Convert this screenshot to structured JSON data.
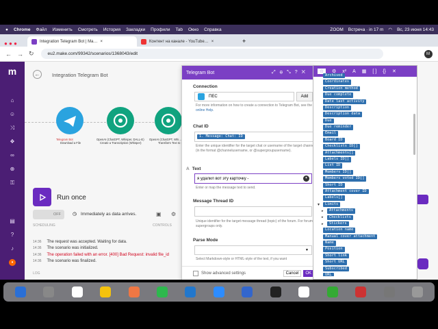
{
  "menubar": {
    "app": "Chrome",
    "items": [
      "Файл",
      "Изменить",
      "Смотреть",
      "История",
      "Закладки",
      "Профили",
      "Tab",
      "Окно",
      "Справка"
    ],
    "zoom": "ZOOM",
    "meeting": "Встреча · in 17 m",
    "datetime": "Вс, 23 июня 14:43"
  },
  "tabs": [
    {
      "label": "Integration Telegram Bot | Ma…",
      "active": true
    },
    {
      "label": "Контент на канале - YouTube…",
      "active": false
    }
  ],
  "address": {
    "url": "eu2.make.com/99342/scenarios/1368043/edit",
    "profile": "M"
  },
  "scenario": {
    "title": "Integration Telegram Bot",
    "nodes": [
      {
        "label": "Telegram Bot",
        "sub": "Download a File",
        "badge": "1"
      },
      {
        "label": "OpenAI (ChatGPT, Whisper, DALL-E)",
        "sub": "Create a Transcription (Whisper)",
        "badge": "2"
      },
      {
        "label": "OpenAI (ChatGPT, Whi…",
        "sub": "Transform Text to Speech",
        "badge": "3"
      }
    ],
    "run_once": "Run once",
    "toggle": "OFF",
    "schedule_text": "Immediately as data arrives.",
    "scheduling_label": "SCHEDULING",
    "controls_label": "CONTROLS",
    "log_label": "LOG",
    "logs": [
      {
        "time": "14:36",
        "text": "The request was accepted. Waiting for data.",
        "error": false
      },
      {
        "time": "14:36",
        "text": "The scenario was initialized.",
        "error": false
      },
      {
        "time": "14:36",
        "text": "The operation failed with an error. [400] Bad Request: invalid file_id",
        "error": true
      },
      {
        "time": "14:36",
        "text": "The scenario was finalized.",
        "error": false
      }
    ]
  },
  "panel": {
    "title": "Telegram Bot",
    "connection_title": "Connection",
    "connection_value": "ПЕС",
    "add_label": "Add",
    "connection_help": "For more information on how to create a connection to Telegram Bot, see the",
    "online_help": "online Help.",
    "chatid_title": "Chat ID",
    "chatid_chip": "1. Message: Chat: ID",
    "chatid_help": "Enter the unique identifier for the target chat or username of the target channel (in the format @channelusername, or @supergroupusername).",
    "text_title": "Text",
    "text_value": "я удалил вот эту карточку -",
    "text_help": "Enter or map the message text to send.",
    "thread_title": "Message Thread ID",
    "thread_help": "Unique identifier for the target message thread (topic) of the forum. For forum supergroups only.",
    "parse_title": "Parse Mode",
    "parse_help": "Select Markdown-style or HTML-style of the text, if you want",
    "advanced_label": "Show advanced settings",
    "cancel_label": "Cancel",
    "ok_label": "OK"
  },
  "picker": {
    "items": [
      {
        "label": "Archived",
        "sub": false
      },
      {
        "label": "Coordinates",
        "sub": false
      },
      {
        "label": "Creation method",
        "sub": false
      },
      {
        "label": "Due complete",
        "sub": false
      },
      {
        "label": "Date last activity",
        "sub": false
      },
      {
        "label": "Description",
        "sub": false
      },
      {
        "label": "Description data",
        "sub": false
      },
      {
        "label": "Due",
        "sub": false
      },
      {
        "label": "Due reminder",
        "sub": false
      },
      {
        "label": "Email",
        "sub": false
      },
      {
        "label": "Board ID",
        "sub": false
      },
      {
        "label": "Checklists ID[]",
        "sub": false
      },
      {
        "label": "Attachments[]",
        "sub": false
      },
      {
        "label": "Labels ID[]",
        "sub": false
      },
      {
        "label": "List ID",
        "sub": false
      },
      {
        "label": "Members ID[]",
        "sub": false
      },
      {
        "label": "Members voted ID[]",
        "sub": false
      },
      {
        "label": "Short ID",
        "sub": false
      },
      {
        "label": "Attachment cover ID",
        "sub": false
      },
      {
        "label": "Labels[]",
        "sub": false
      },
      {
        "label": "Limits",
        "sub": false
      },
      {
        "label": "Attachments",
        "sub": true
      },
      {
        "label": "Checklists",
        "sub": true
      },
      {
        "label": "Stickers",
        "sub": true
      },
      {
        "label": "Location name",
        "sub": false
      },
      {
        "label": "Manual cover attachment",
        "sub": false
      },
      {
        "label": "Name",
        "sub": false
      },
      {
        "label": "Position",
        "sub": false
      },
      {
        "label": "Short link",
        "sub": false
      },
      {
        "label": "Short URL",
        "sub": false
      },
      {
        "label": "Subscribed",
        "sub": false
      },
      {
        "label": "URL",
        "sub": false
      }
    ]
  },
  "colors": {
    "make_purple": "#7b3fc4",
    "telegram": "#2aa3df",
    "openai": "#10a37f",
    "chip": "#2e6fae",
    "error": "#d0021b"
  }
}
